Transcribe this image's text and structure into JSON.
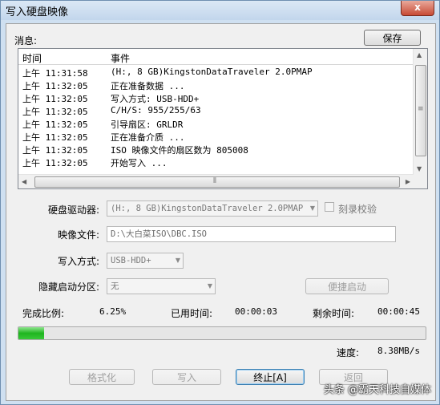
{
  "window": {
    "title": "写入硬盘映像",
    "close_glyph": "x"
  },
  "messages": {
    "label": "消息:",
    "save_button": "保存",
    "columns": {
      "time": "时间",
      "event": "事件"
    },
    "rows": [
      {
        "time": "上午 11:31:58",
        "event": "(H:, 8 GB)KingstonDataTraveler 2.0PMAP"
      },
      {
        "time": "上午 11:32:05",
        "event": "正在准备数据 ..."
      },
      {
        "time": "上午 11:32:05",
        "event": "写入方式: USB-HDD+"
      },
      {
        "time": "上午 11:32:05",
        "event": "C/H/S: 955/255/63"
      },
      {
        "time": "上午 11:32:05",
        "event": "引导扇区: GRLDR"
      },
      {
        "time": "上午 11:32:05",
        "event": "正在准备介质 ..."
      },
      {
        "time": "上午 11:32:05",
        "event": "ISO 映像文件的扇区数为 805008"
      },
      {
        "time": "上午 11:32:05",
        "event": "开始写入 ..."
      }
    ]
  },
  "form": {
    "drive_label": "硬盘驱动器:",
    "drive_value": "(H:, 8 GB)KingstonDataTraveler 2.0PMAP",
    "verify_label": "刻录校验",
    "image_label": "映像文件:",
    "image_value": "D:\\大白菜ISO\\DBC.ISO",
    "method_label": "写入方式:",
    "method_value": "USB-HDD+",
    "hidden_label": "隐藏启动分区:",
    "hidden_value": "无",
    "quick_boot_button": "便捷启动"
  },
  "progress": {
    "percent_label": "完成比例:",
    "percent_value": "6.25%",
    "elapsed_label": "已用时间:",
    "elapsed_value": "00:00:03",
    "remaining_label": "剩余时间:",
    "remaining_value": "00:00:45",
    "fraction": 0.0625,
    "speed_label": "速度:",
    "speed_value": "8.38MB/s"
  },
  "actions": {
    "format": "格式化",
    "write": "写入",
    "stop": "终止[A]",
    "back": "返回"
  },
  "watermark": "头条 @霸天科技自媒体",
  "colors": {
    "progress_fill": "#1fb51f",
    "title_bar": "#c2d6ec",
    "close_button": "#c74a35"
  }
}
